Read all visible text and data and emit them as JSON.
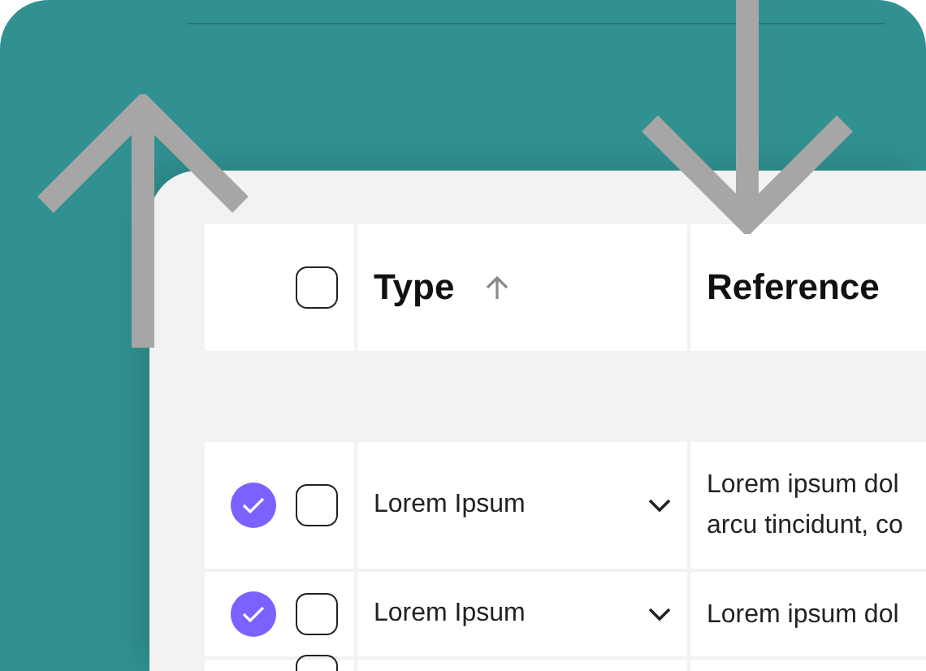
{
  "table": {
    "select_all_checked": false,
    "columns": [
      {
        "label": "Type",
        "sorted_ascending": true
      },
      {
        "label": "Reference",
        "sorted_ascending": false
      }
    ],
    "rows": [
      {
        "selected": true,
        "checked": false,
        "type": "Lorem Ipsum",
        "reference": "Lorem ipsum dol\narcu tincidunt, co"
      },
      {
        "selected": true,
        "checked": false,
        "type": "Lorem Ipsum",
        "reference": "Lorem ipsum dol"
      },
      {
        "selected": false,
        "checked": false
      }
    ]
  }
}
